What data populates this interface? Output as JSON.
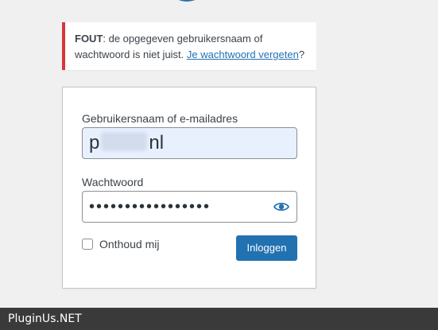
{
  "error": {
    "prefix": "FOUT",
    "message": ": de opgegeven gebruikersnaam of wachtwoord is niet juist. ",
    "link_text": "Je wachtwoord vergeten",
    "suffix": "?",
    "border_color": "#d63638"
  },
  "form": {
    "username_label": "Gebruikersnaam of e-mailadres",
    "username_value_start": "p",
    "username_value_end": "nl",
    "password_label": "Wachtwoord",
    "password_value": "•••••••••••••••••",
    "remember_label": "Onthoud mij",
    "remember_checked": false,
    "submit_label": "Inloggen",
    "accent_color": "#2271b1"
  },
  "watermark": {
    "text": "PluginUs.NET"
  },
  "icons": {
    "password_toggle": "eye-icon",
    "logo": "wordpress-logo"
  }
}
